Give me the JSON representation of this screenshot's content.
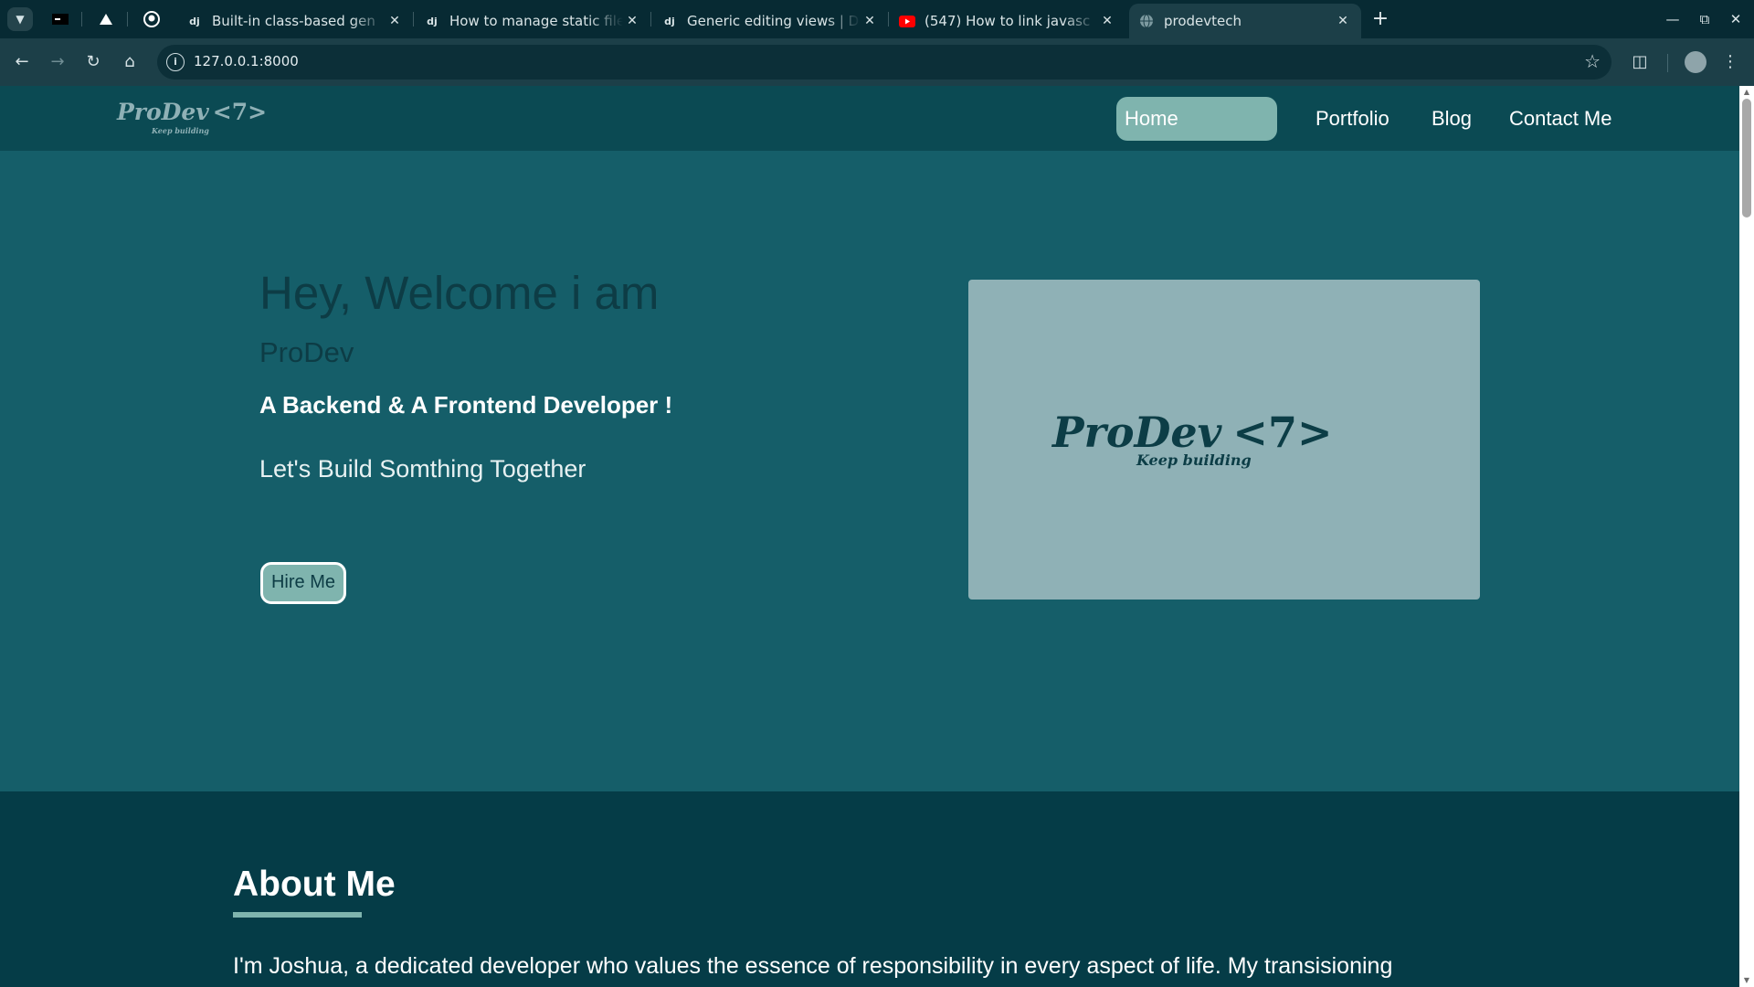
{
  "browser": {
    "tabs": [
      {
        "title": "Built-in class-based gen",
        "favicon": "dj"
      },
      {
        "title": "How to manage static file",
        "favicon": "dj"
      },
      {
        "title": "Generic editing views | D",
        "favicon": "dj"
      },
      {
        "title": "(547) How to link javasc",
        "favicon": "youtube-icon"
      },
      {
        "title": "prodevtech",
        "favicon": "globe-icon"
      }
    ],
    "url": "127.0.0.1:8000"
  },
  "site": {
    "logo": {
      "name": "ProDev",
      "tagline": "Keep building",
      "mark": "<7>"
    },
    "nav": [
      "Home",
      "Portfolio",
      "Blog",
      "Contact Me"
    ],
    "active_nav": "Home",
    "hero": {
      "heading": "Hey, Welcome i am",
      "name": "ProDev",
      "role": "A Backend & A Frontend Developer !",
      "tagline": "Let's Build Somthing Together",
      "cta": "Hire Me"
    },
    "about": {
      "title": "About Me",
      "text": "I'm Joshua, a dedicated developer who values the essence of responsibility in every aspect of life. My transisioning"
    }
  },
  "colors": {
    "nav_bg": "#0b4a53",
    "hero_bg": "#155e69",
    "accent": "#7fb4ae",
    "card_bg": "#8fb1b6",
    "about_bg": "#053c47"
  }
}
